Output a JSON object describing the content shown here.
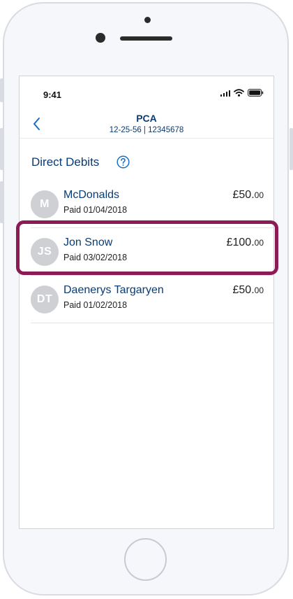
{
  "status_bar": {
    "time": "9:41",
    "icons": [
      "signal-icon",
      "wifi-icon",
      "battery-icon"
    ]
  },
  "header": {
    "title": "PCA",
    "account_details": "12-25-56 | 12345678",
    "back_icon": "chevron-left-icon"
  },
  "section": {
    "title": "Direct Debits",
    "help_icon": "question-circle-icon"
  },
  "direct_debits": [
    {
      "initials": "M",
      "name": "McDonalds",
      "paid": "Paid 01/04/2018",
      "amount_main": "£50.",
      "amount_pence": "00"
    },
    {
      "initials": "JS",
      "name": "Jon Snow",
      "paid": "Paid 03/02/2018",
      "amount_main": "£100.",
      "amount_pence": "00",
      "highlighted": true
    },
    {
      "initials": "DT",
      "name": "Daenerys Targaryen",
      "paid": "Paid 01/02/2018",
      "amount_main": "£50.",
      "amount_pence": "00"
    }
  ],
  "colors": {
    "brand_navy": "#0a3b73",
    "highlight": "#8b1a55",
    "avatar_bg": "#cfd0d4"
  }
}
